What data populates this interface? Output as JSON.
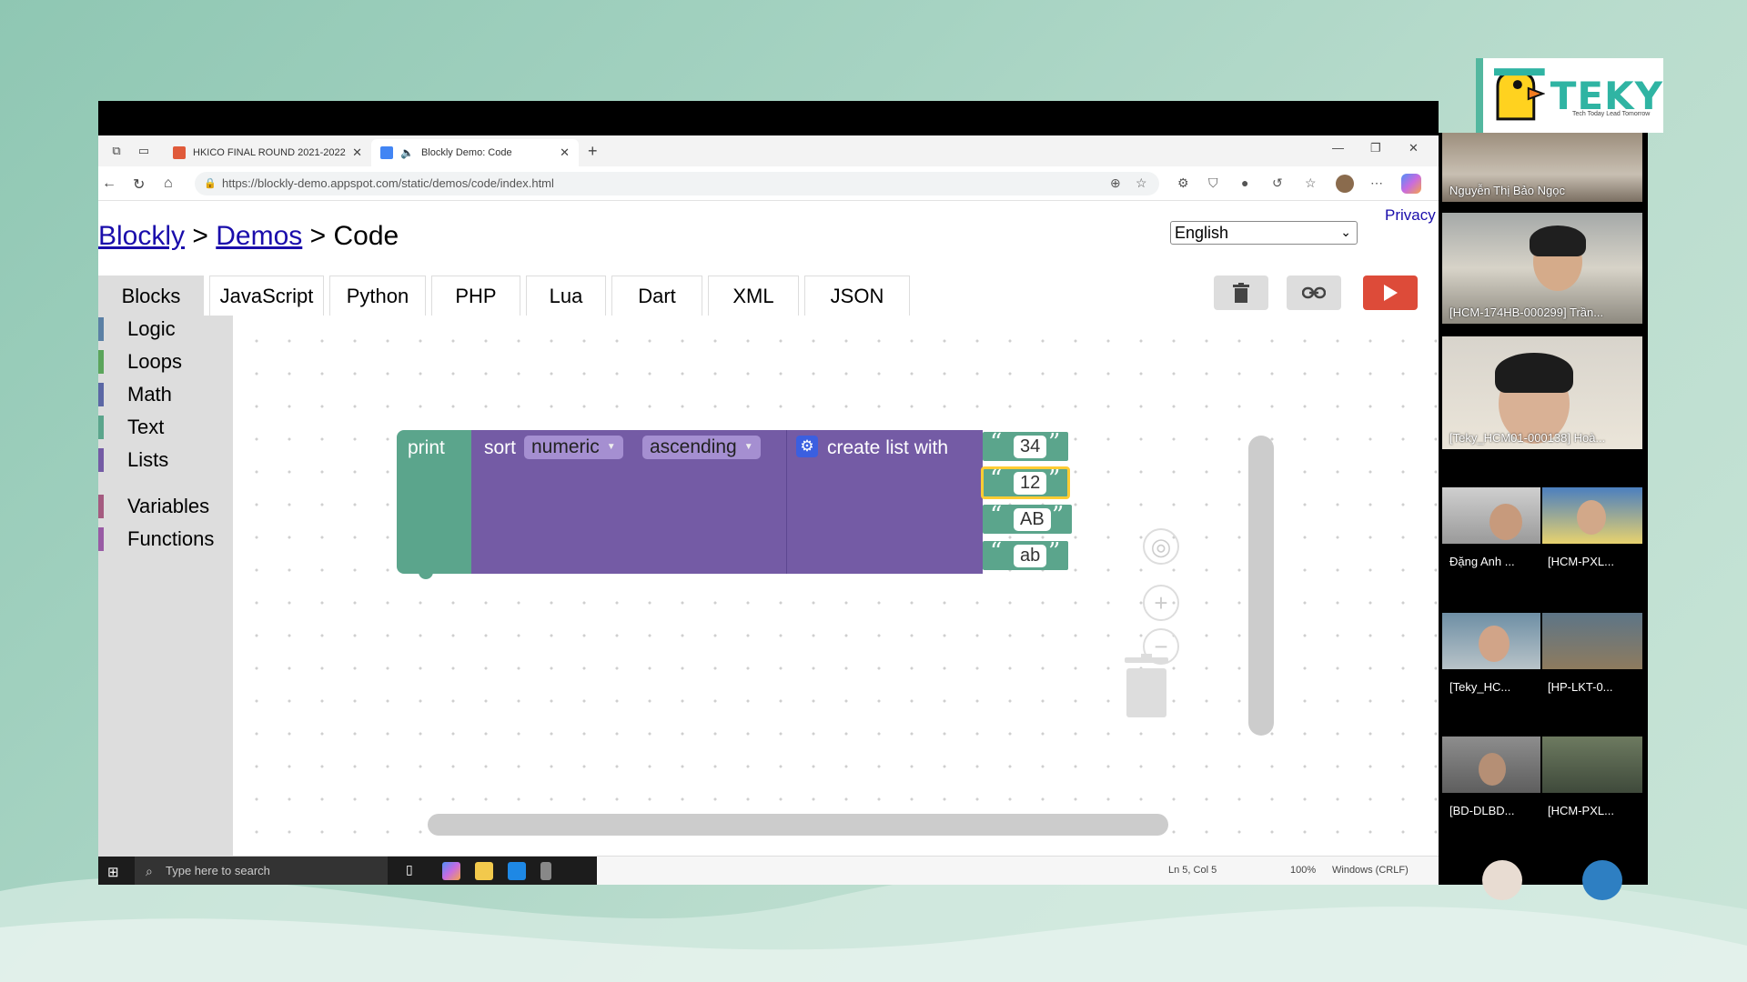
{
  "logo": {
    "brand": "TEKY",
    "tagline": "Tech Today Lead Tomorrow"
  },
  "browser": {
    "tabs": [
      {
        "label": "HKICO FINAL ROUND 2021-2022"
      },
      {
        "label": "Blockly Demo: Code"
      }
    ],
    "url": "https://blockly-demo.appspot.com/static/demos/code/index.html"
  },
  "page": {
    "breadcrumb": {
      "blockly": "Blockly",
      "sep1": ">",
      "demos": "Demos",
      "sep2": ">",
      "current": "Code"
    },
    "privacy_link": "Privacy",
    "language_select": {
      "selected": "English"
    },
    "code_tabs": [
      "Blocks",
      "JavaScript",
      "Python",
      "PHP",
      "Lua",
      "Dart",
      "XML",
      "JSON"
    ],
    "selected_tab": "Blocks",
    "toolbox": [
      {
        "label": "Logic",
        "color": "#5b80a5"
      },
      {
        "label": "Loops",
        "color": "#5ba55b"
      },
      {
        "label": "Math",
        "color": "#5b67a5"
      },
      {
        "label": "Text",
        "color": "#5ba58c"
      },
      {
        "label": "Lists",
        "color": "#745ba5"
      },
      {
        "label": "Variables",
        "color": "#a55b80"
      },
      {
        "label": "Functions",
        "color": "#995ba5"
      }
    ],
    "blocks": {
      "print_label": "print",
      "sort_label": "sort",
      "sort_type": "numeric",
      "sort_order": "ascending",
      "create_list_label": "create list with",
      "items": [
        "34",
        "12",
        "AB",
        "ab"
      ],
      "open_quote": "“",
      "close_quote": "”"
    }
  },
  "taskbar": {
    "search_placeholder": "Type here to search",
    "cursor_position": "Ln 5, Col 5",
    "zoom": "100%",
    "line_endings": "Windows (CRLF)"
  },
  "participants": [
    "Nguyễn Thị Bảo Ngọc",
    "[HCM-174HB-000299] Trần...",
    "[Teky_HCM01-000138] Hoà...",
    "Đặng Anh ...",
    "[HCM-PXL...",
    "[Teky_HC...",
    "[HP-LKT-0...",
    "[BD-DLBD...",
    "[HCM-PXL..."
  ]
}
